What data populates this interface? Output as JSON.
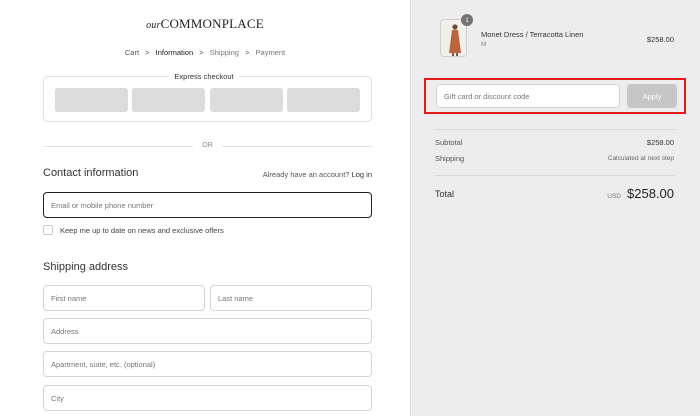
{
  "brand": {
    "script": "our",
    "name": "COMMONPLACE"
  },
  "breadcrumb": {
    "items": [
      "Cart",
      "Information",
      "Shipping",
      "Payment"
    ],
    "separator": ">"
  },
  "express_checkout": {
    "title": "Express checkout",
    "button_count": 4
  },
  "divider_text": "OR",
  "contact": {
    "heading": "Contact information",
    "account_prompt": "Already have an account?",
    "login_link": "Log in",
    "email_placeholder": "Email or mobile phone number",
    "newsletter_label": "Keep me up to date on news and exclusive offers"
  },
  "shipping": {
    "heading": "Shipping address",
    "first_name_placeholder": "First name",
    "last_name_placeholder": "Last name",
    "address_placeholder": "Address",
    "apartment_placeholder": "Apartment, suite, etc. (optional)",
    "city_placeholder": "City"
  },
  "order": {
    "product": {
      "name": "Monet Dress / Terracotta Linen",
      "variant": "M",
      "price": "$258.00",
      "quantity": "1"
    },
    "discount_placeholder": "Gift card or discount code",
    "apply_label": "Apply",
    "subtotal_label": "Subtotal",
    "subtotal_value": "$258.00",
    "shipping_label": "Shipping",
    "shipping_value": "Calculated at next step",
    "total_label": "Total",
    "total_currency": "USD",
    "total_value": "$258.00"
  },
  "colors": {
    "highlight": "#e01b1b",
    "apply_button": "#c6c6c6",
    "sidebar_bg": "#ededed"
  }
}
